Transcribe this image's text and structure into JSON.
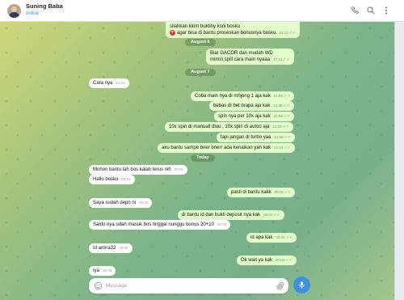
{
  "header": {
    "name": "Suning Baba",
    "status": "online",
    "icons": [
      "phone-icon",
      "search-icon",
      "more-vertical-icon"
    ]
  },
  "messages": [
    {
      "dir": "out",
      "lines": [
        "silahkan kirim buktiny ksni bosku",
        "agar bisa di bantu proseskan bonusnya bosku"
      ],
      "time": "22:10",
      "ticks": "✓✓"
    },
    {
      "date": "August 6"
    },
    {
      "dir": "out",
      "lines": [
        "Biar GACOR dan mudah WD",
        "mimin spill cara main nyaaa"
      ],
      "time": "17:42",
      "ticks": "✓✓"
    },
    {
      "date": "August 7"
    },
    {
      "dir": "in",
      "text": "Cara nya",
      "time": "21:14"
    },
    {
      "dir": "out",
      "text": "Coba main nya di mhjong 1 aja kak",
      "time": "21:56",
      "ticks": "✓✓"
    },
    {
      "dir": "out",
      "text": "bebas di bet brapa aja kak",
      "time": "21:58",
      "ticks": "✓✓"
    },
    {
      "dir": "out",
      "text": "spin nya per 10x aja kak",
      "time": "21:59",
      "ticks": "✓✓"
    },
    {
      "dir": "out",
      "text": "10x spin di manuall dluu , 10x spin di autoo aja",
      "time": "21:59",
      "ticks": "✓✓"
    },
    {
      "dir": "out",
      "text": "tapi jangan di turbo yaa",
      "time": "21:59",
      "ticks": "✓✓"
    },
    {
      "dir": "out",
      "text": "aku bantu sampe bner bnerr ada kenaikan yah kak",
      "time": "21:59",
      "ticks": "✓✓"
    },
    {
      "date": "Today"
    },
    {
      "dir": "in",
      "text": "Mohon bantu lah bos kalah terus nih",
      "time": "00:01"
    },
    {
      "dir": "in",
      "text": "Hallo bosku",
      "time": "00:01"
    },
    {
      "dir": "out",
      "text": "pasti di bantu kakk",
      "time": "00:02",
      "ticks": "✓✓"
    },
    {
      "dir": "in",
      "text": "Saya sudah depo ni",
      "time": "00:02"
    },
    {
      "dir": "out",
      "text": "di bantu id dan bukti deposit nya kak",
      "time": "00:03",
      "ticks": "✓✓"
    },
    {
      "dir": "in",
      "text": "Saldo nya udah masuk bos tinggal nunggu bonus 20+10",
      "time": "00:03"
    },
    {
      "dir": "out",
      "text": "id apa kak",
      "time": "00:04",
      "ticks": "✓✓"
    },
    {
      "dir": "in",
      "text": "Id amira32",
      "time": "00:04"
    },
    {
      "dir": "out",
      "text": "Ok wait ya kak",
      "time": "00:04",
      "ticks": "✓✓"
    },
    {
      "dir": "in",
      "text": "Iya",
      "time": "00:05"
    }
  ],
  "composer": {
    "placeholder": "Message",
    "icons": [
      "emoji-icon",
      "attach-icon",
      "microphone-icon"
    ]
  },
  "colors": {
    "outgoing_bubble": "#e2fdc9",
    "incoming_bubble": "#ffffff",
    "accent": "#3e91e0",
    "status": "#3a8fd8"
  }
}
